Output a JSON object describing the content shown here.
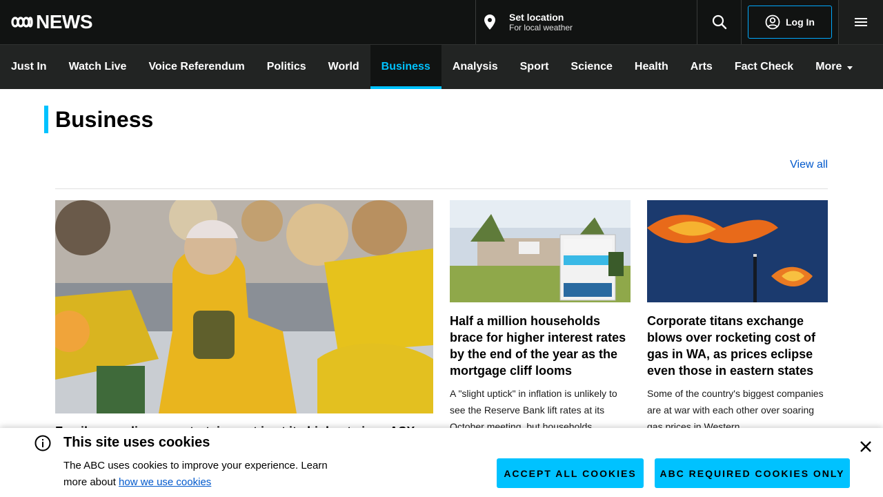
{
  "header": {
    "logo_text": "NEWS",
    "location_title": "Set location",
    "location_subtitle": "For local weather",
    "login_label": "Log In"
  },
  "nav": {
    "items": [
      "Just In",
      "Watch Live",
      "Voice Referendum",
      "Politics",
      "World",
      "Business",
      "Analysis",
      "Sport",
      "Science",
      "Health",
      "Arts",
      "Fact Check",
      "More"
    ],
    "active": "Business"
  },
  "section": {
    "title": "Business",
    "view_all": "View all"
  },
  "cards": [
    {
      "headline": "Family spending on entertainment is at its highest since ASX…",
      "image_desc": "crowd-matildas-fans"
    },
    {
      "headline": "Half a million households brace for higher interest rates by the end of the year as the mortgage cliff looms",
      "summary": "A \"slight uptick\" in inflation is unlikely to see the Reserve Bank lift rates at its October meeting, but households",
      "image_desc": "for-sale-sign"
    },
    {
      "headline": "Corporate titans exchange blows over rocketing cost of gas in WA, as prices eclipse even those in eastern states",
      "summary": "Some of the country's biggest companies are at war with each other over soaring gas prices in Western",
      "image_desc": "gas-flare"
    }
  ],
  "cookie_banner": {
    "title": "This site uses cookies",
    "body": "The ABC uses cookies to improve your experience. Learn more about ",
    "link": "how we use cookies",
    "accept_all": "ACCEPT ALL COOKIES",
    "required_only": "ABC REQUIRED COOKIES ONLY"
  },
  "colors": {
    "header_bg": "#111312",
    "nav_bg": "#222423",
    "accent": "#00c2ff",
    "link": "#0058cc"
  }
}
